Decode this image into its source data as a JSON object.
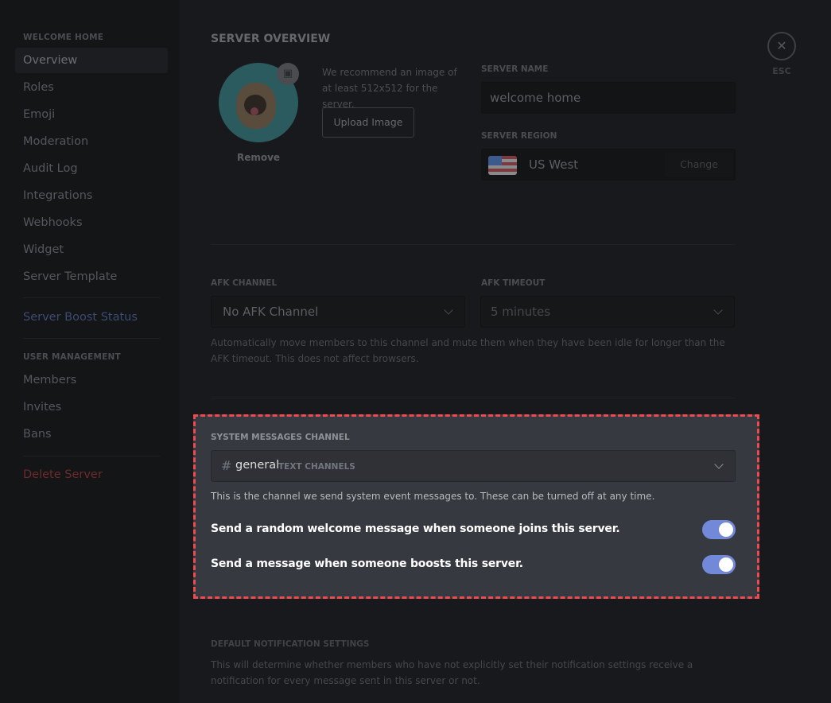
{
  "sidebar": {
    "server_header": "WELCOME HOME",
    "items": [
      "Overview",
      "Roles",
      "Emoji",
      "Moderation",
      "Audit Log",
      "Integrations",
      "Webhooks",
      "Widget",
      "Server Template"
    ],
    "boost": "Server Boost Status",
    "user_header": "USER MANAGEMENT",
    "user_items": [
      "Members",
      "Invites",
      "Bans"
    ],
    "delete": "Delete Server"
  },
  "overview": {
    "title": "SERVER OVERVIEW",
    "remove": "Remove",
    "recommend": "We recommend an image of at least 512x512 for the server.",
    "upload": "Upload Image",
    "name_label": "SERVER NAME",
    "name_value": "welcome home",
    "region_label": "SERVER REGION",
    "region_value": "US West",
    "change": "Change"
  },
  "close": {
    "esc": "ESC"
  },
  "afk": {
    "channel_label": "AFK CHANNEL",
    "channel_value": "No AFK Channel",
    "timeout_label": "AFK TIMEOUT",
    "timeout_value": "5 minutes",
    "help": "Automatically move members to this channel and mute them when they have been idle for longer than the AFK timeout. This does not affect browsers."
  },
  "system": {
    "label": "SYSTEM MESSAGES CHANNEL",
    "hash": "#",
    "channel": "general",
    "category": "TEXT CHANNELS",
    "help": "This is the channel we send system event messages to. These can be turned off at any time.",
    "toggles": [
      {
        "label": "Send a random welcome message when someone joins this server.",
        "on": true
      },
      {
        "label": "Send a message when someone boosts this server.",
        "on": true
      }
    ]
  },
  "notifications": {
    "label": "DEFAULT NOTIFICATION SETTINGS",
    "help": "This will determine whether members who have not explicitly set their notification settings receive a notification for every message sent in this server or not."
  },
  "colors": {
    "accent": "#7289da",
    "highlight": "#f04a4f",
    "delete": "#f04747",
    "boost": "#7289da"
  }
}
